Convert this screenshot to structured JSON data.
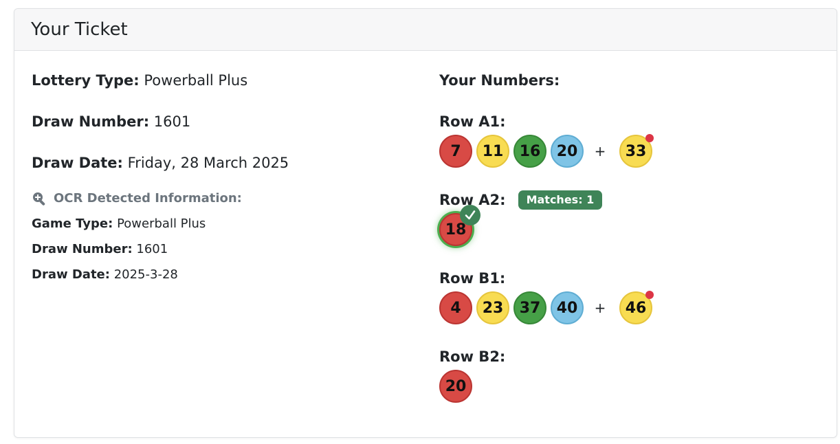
{
  "card": {
    "title": "Your Ticket"
  },
  "details": [
    {
      "label": "Lottery Type:",
      "value": "Powerball Plus"
    },
    {
      "label": "Draw Number:",
      "value": "1601"
    },
    {
      "label": "Draw Date:",
      "value": "Friday, 28 March 2025"
    }
  ],
  "ocr": {
    "heading": "OCR Detected Information:",
    "icon": "search-plus-icon",
    "lines": [
      {
        "label": "Game Type:",
        "value": "Powerball Plus"
      },
      {
        "label": "Draw Number:",
        "value": "1601"
      },
      {
        "label": "Draw Date:",
        "value": "2025-3-28"
      }
    ]
  },
  "numbers": {
    "heading": "Your Numbers:",
    "plus_symbol": "+",
    "colors": {
      "red": "#d84a45",
      "yellow": "#f8dc52",
      "green": "#46a047",
      "blue": "#7fc4e6",
      "match": "#3f8458",
      "bonus_dot": "#dc3545"
    },
    "rows": [
      {
        "label": "Row A1:",
        "balls": [
          {
            "n": "7",
            "c": "red"
          },
          {
            "n": "11",
            "c": "yellow"
          },
          {
            "n": "16",
            "c": "green"
          },
          {
            "n": "20",
            "c": "blue"
          }
        ],
        "bonus": {
          "n": "33",
          "c": "yellow"
        }
      },
      {
        "label": "Row A2:",
        "badge": "Matches: 1",
        "balls": [
          {
            "n": "18",
            "c": "red",
            "matched": true
          }
        ]
      },
      {
        "label": "Row B1:",
        "balls": [
          {
            "n": "4",
            "c": "red"
          },
          {
            "n": "23",
            "c": "yellow"
          },
          {
            "n": "37",
            "c": "green"
          },
          {
            "n": "40",
            "c": "blue"
          }
        ],
        "bonus": {
          "n": "46",
          "c": "yellow"
        }
      },
      {
        "label": "Row B2:",
        "balls": [
          {
            "n": "20",
            "c": "red"
          }
        ]
      }
    ]
  }
}
